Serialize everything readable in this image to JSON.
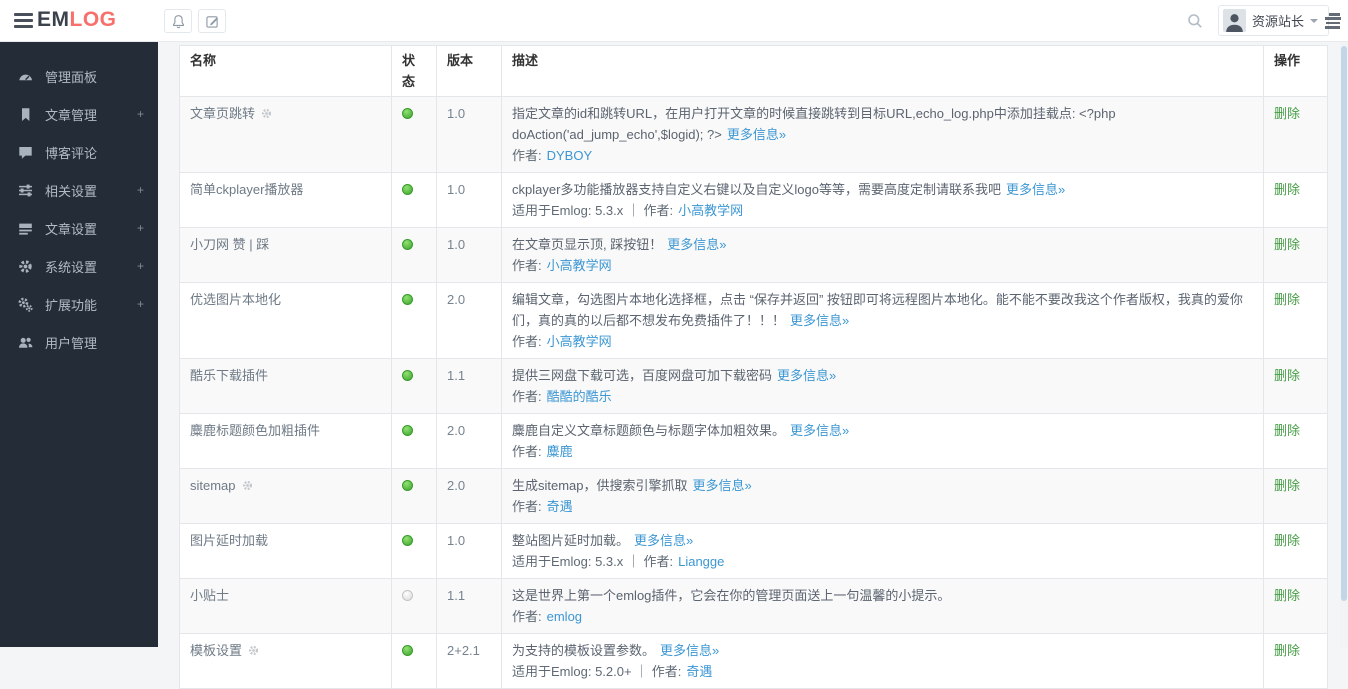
{
  "topbar": {
    "logo_em": "EM",
    "logo_log": "LOG",
    "user_name": "资源站长"
  },
  "sidebar": {
    "expand_symbol": "+",
    "items": [
      {
        "label": "管理面板",
        "icon": "gauge-icon",
        "expandable": false
      },
      {
        "label": "文章管理",
        "icon": "bookmark-icon",
        "expandable": true
      },
      {
        "label": "博客评论",
        "icon": "comment-icon",
        "expandable": false
      },
      {
        "label": "相关设置",
        "icon": "sliders-icon",
        "expandable": true
      },
      {
        "label": "文章设置",
        "icon": "list-icon",
        "expandable": true
      },
      {
        "label": "系统设置",
        "icon": "gear-icon",
        "expandable": true
      },
      {
        "label": "扩展功能",
        "icon": "cogs-icon",
        "expandable": true
      },
      {
        "label": "用户管理",
        "icon": "users-icon",
        "expandable": false
      }
    ]
  },
  "table": {
    "headers": {
      "name": "名称",
      "status": "状态",
      "version": "版本",
      "description": "描述",
      "action": "操作"
    },
    "action_label": "删除",
    "rows": [
      {
        "name": "文章页跳转",
        "gear": true,
        "status": "on",
        "version": "1.0",
        "desc": "指定文章的id和跳转URL，在用户打开文章的时候直接跳转到目标URL,echo_log.php中添加挂载点: <?php doAction('ad_jump_echo',$logid); ?>",
        "more": "更多信息»",
        "meta_prefix": "作者:",
        "author": "DYBOY"
      },
      {
        "name": "简单ckplayer播放器",
        "gear": false,
        "status": "on",
        "version": "1.0",
        "desc": "ckplayer多功能播放器支持自定义右键以及自定义logo等等，需要高度定制请联系我吧",
        "more": "更多信息»",
        "meta_prefix": "适用于Emlog: 5.3.x ｜ 作者:",
        "author": "小高教学网"
      },
      {
        "name": "小刀网 赞 | 踩",
        "gear": false,
        "status": "on",
        "version": "1.0",
        "desc": "在文章页显示顶, 踩按钮！",
        "more": "更多信息»",
        "meta_prefix": "作者:",
        "author": "小高教学网"
      },
      {
        "name": "优选图片本地化",
        "gear": false,
        "status": "on",
        "version": "2.0",
        "desc": "编辑文章，勾选图片本地化选择框，点击 “保存并返回” 按钮即可将远程图片本地化。能不能不要改我这个作者版权，我真的爱你们，真的真的以后都不想发布免费插件了！！！",
        "more": "更多信息»",
        "meta_prefix": "作者:",
        "author": "小高教学网"
      },
      {
        "name": "酷乐下载插件",
        "gear": false,
        "status": "on",
        "version": "1.1",
        "desc": "提供三网盘下载可选，百度网盘可加下载密码",
        "more": "更多信息»",
        "meta_prefix": "作者:",
        "author": "酷酷的酷乐"
      },
      {
        "name": "麋鹿标题颜色加粗插件",
        "gear": false,
        "status": "on",
        "version": "2.0",
        "desc": "麋鹿自定义文章标题颜色与标题字体加粗效果。",
        "more": "更多信息»",
        "meta_prefix": "作者:",
        "author": "麋鹿"
      },
      {
        "name": "sitemap",
        "gear": true,
        "status": "on",
        "version": "2.0",
        "desc": "生成sitemap，供搜索引擎抓取",
        "more": "更多信息»",
        "meta_prefix": "作者:",
        "author": "奇遇"
      },
      {
        "name": "图片延时加载",
        "gear": false,
        "status": "on",
        "version": "1.0",
        "desc": "整站图片延时加载。",
        "more": "更多信息»",
        "meta_prefix": "适用于Emlog: 5.3.x ｜ 作者:",
        "author": "Liangge"
      },
      {
        "name": "小贴士",
        "gear": false,
        "status": "off",
        "version": "1.1",
        "desc": "这是世界上第一个emlog插件，它会在你的管理页面送上一句温馨的小提示。",
        "more": "",
        "meta_prefix": "作者:",
        "author": "emlog"
      },
      {
        "name": "模板设置",
        "gear": true,
        "status": "on",
        "version": "2+2.1",
        "desc": "为支持的模板设置参数。",
        "more": "更多信息»",
        "meta_prefix": "适用于Emlog: 5.2.0+ ｜ 作者:",
        "author": "奇遇"
      }
    ]
  },
  "colors": {
    "logo_accent": "#f7706b",
    "link_blue": "#3c97d3",
    "delete_green": "#449d44",
    "status_on": "#3da22f",
    "sidebar_bg": "#242c37"
  }
}
